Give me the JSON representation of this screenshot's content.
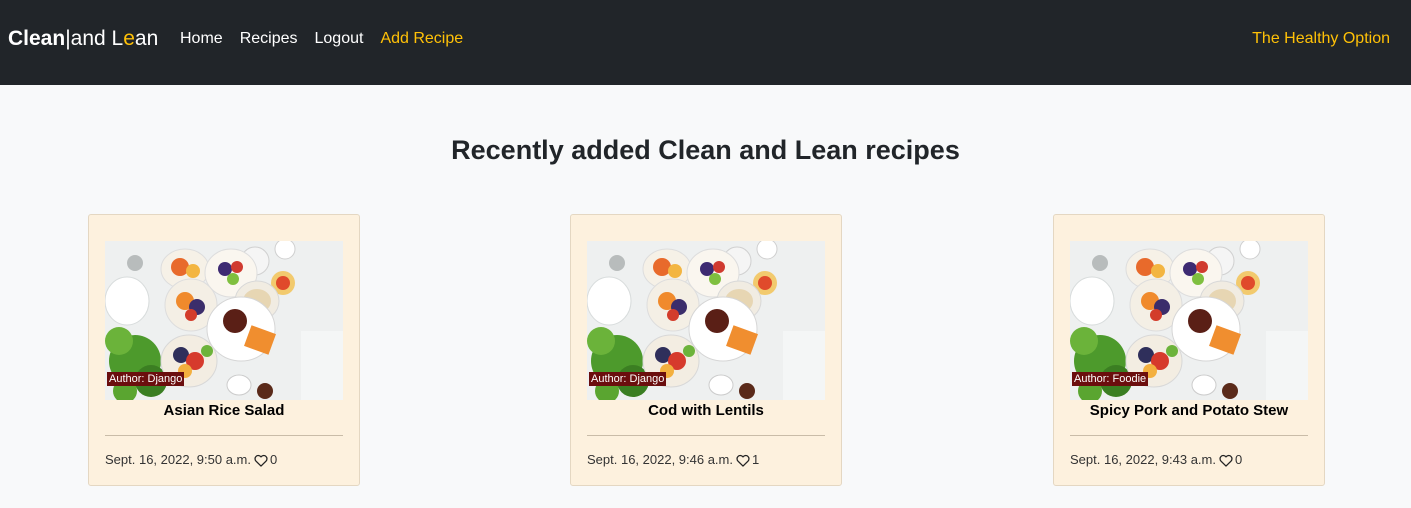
{
  "navbar": {
    "brand": {
      "clean": "Clean",
      "separator": "|",
      "and": "and ",
      "lean_l": "L",
      "lean_e": "e",
      "lean_rest": "an"
    },
    "links": [
      {
        "label": "Home"
      },
      {
        "label": "Recipes"
      },
      {
        "label": "Logout"
      },
      {
        "label": "Add Recipe"
      }
    ],
    "right_text": "The Healthy Option"
  },
  "main": {
    "heading": "Recently added Clean and Lean recipes",
    "recipes": [
      {
        "title": "Asian Rice Salad",
        "author": "Author: Django",
        "date": "Sept. 16, 2022, 9:50 a.m.",
        "likes": "0"
      },
      {
        "title": "Cod with Lentils",
        "author": "Author: Django",
        "date": "Sept. 16, 2022, 9:46 a.m.",
        "likes": "1"
      },
      {
        "title": "Spicy Pork and Potato Stew",
        "author": "Author: Foodie",
        "date": "Sept. 16, 2022, 9:43 a.m.",
        "likes": "0"
      }
    ]
  },
  "colors": {
    "navbar_bg": "#212529",
    "accent": "#ffc107",
    "card_bg": "#fdf1de",
    "author_badge_bg": "#6b0e0e"
  },
  "icons": {
    "like": "heart-outline-icon"
  }
}
